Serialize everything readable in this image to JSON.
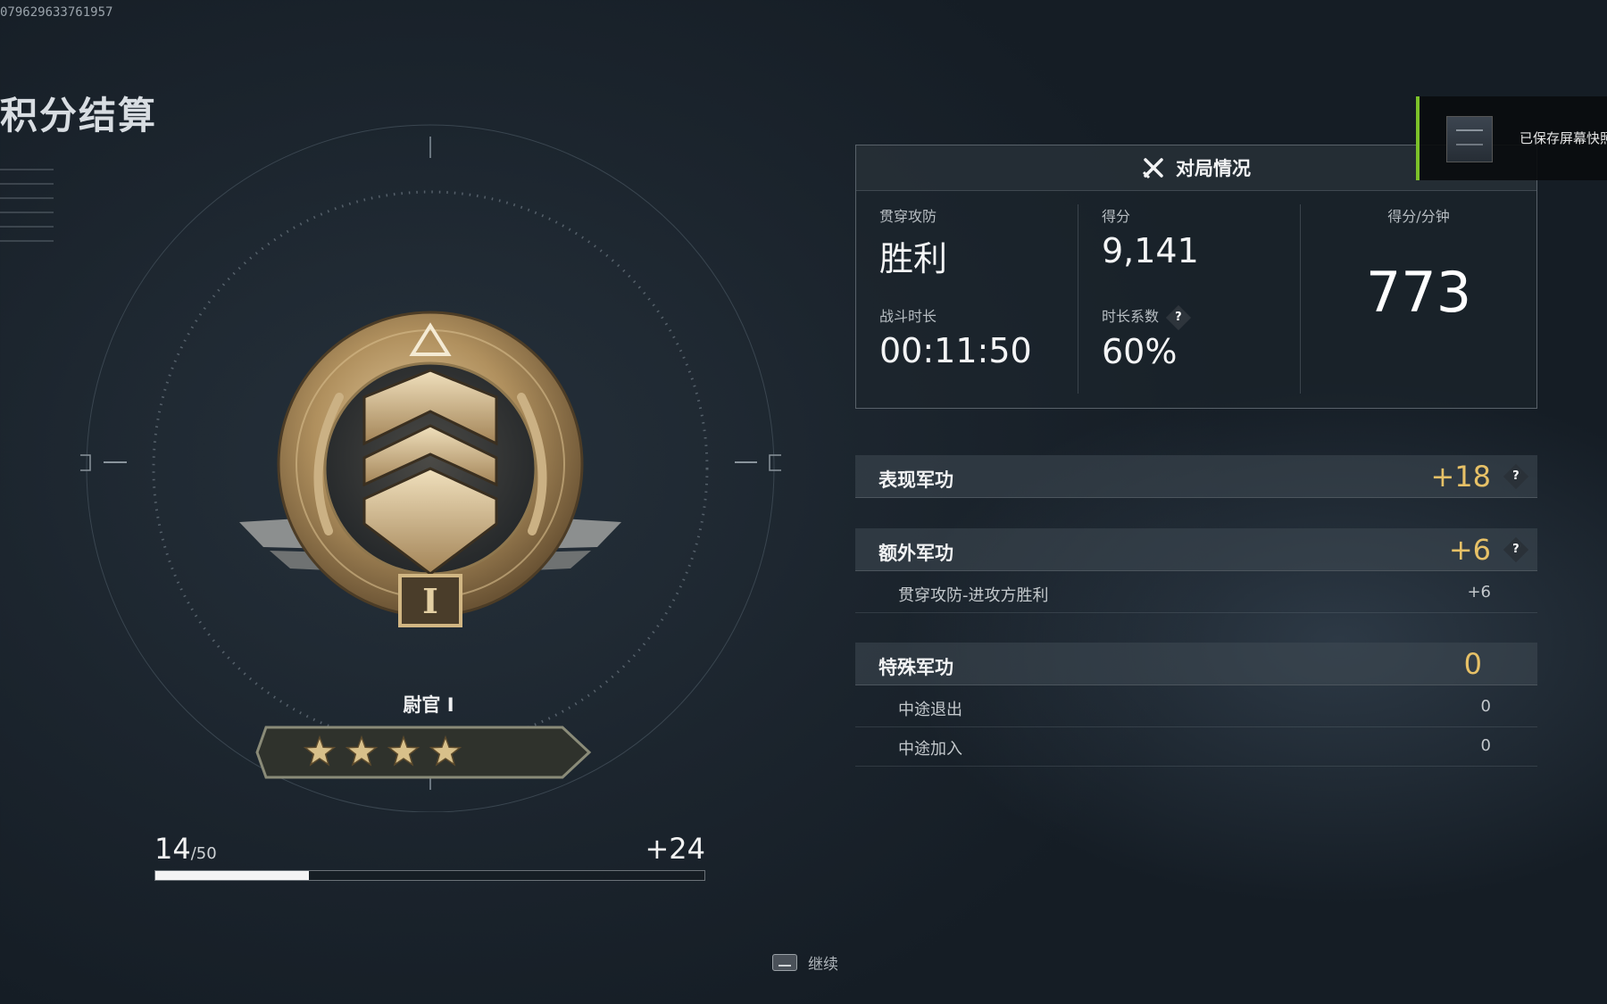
{
  "uid": "079629633761957",
  "page_title": "积分结算",
  "rank": {
    "name": "尉官 I",
    "numeral": "I",
    "stars": 4,
    "colors": {
      "medal_gold": "#b99a6c",
      "medal_dark": "#3d3a35",
      "star": "#d8c08a"
    }
  },
  "progress": {
    "current": "14",
    "max_label": "/50",
    "gain": "+24",
    "fraction": 0.28
  },
  "continue": {
    "label": "继续"
  },
  "match": {
    "title": "对局情况",
    "mode_label": "贯穿攻防",
    "mode_value": "胜利",
    "duration_label": "战斗时长",
    "duration_value": "00:11:50",
    "score_label": "得分",
    "score_value": "9,141",
    "coef_label": "时长系数",
    "coef_value": "60%",
    "spm_label": "得分/分钟",
    "spm_value": "773",
    "help_glyph": "?"
  },
  "merits": {
    "performance": {
      "name": "表现军功",
      "value": "+18"
    },
    "extra": {
      "name": "额外军功",
      "value": "+6",
      "items": [
        {
          "name": "贯穿攻防-进攻方胜利",
          "value": "+6"
        }
      ]
    },
    "special": {
      "name": "特殊军功",
      "value": "0",
      "items": [
        {
          "name": "中途退出",
          "value": "0"
        },
        {
          "name": "中途加入",
          "value": "0"
        }
      ]
    }
  },
  "toast": {
    "text": "已保存屏幕快照"
  },
  "accent_colors": {
    "gold_text": "#e7c167",
    "toast_bar": "#7cc12a"
  }
}
